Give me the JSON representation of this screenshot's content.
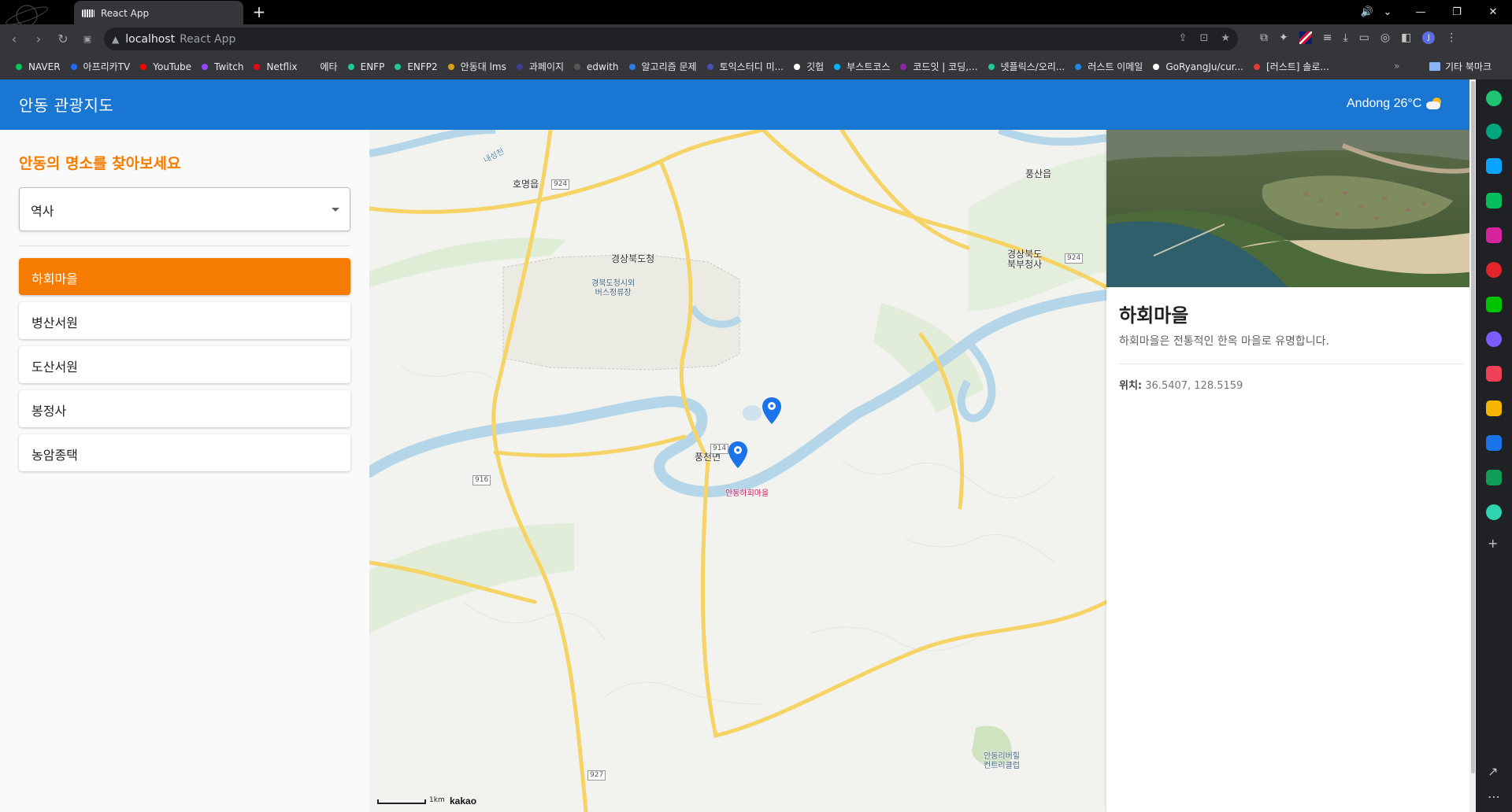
{
  "browser": {
    "tab_title": "React App",
    "new_tab_glyph": "+",
    "address_host": "localhost",
    "address_title": "React App",
    "bookmarks": [
      {
        "label": "NAVER",
        "color": "#03c75a"
      },
      {
        "label": "아프리카TV",
        "color": "#1e6cff"
      },
      {
        "label": "YouTube",
        "color": "#ff0000"
      },
      {
        "label": "Twitch",
        "color": "#9146ff"
      },
      {
        "label": "Netflix",
        "color": "#e50914"
      },
      {
        "label": "에타",
        "color": "#35363a"
      },
      {
        "label": "ENFP",
        "color": "#20c997"
      },
      {
        "label": "ENFP2",
        "color": "#20c997"
      },
      {
        "label": "안동대 lms",
        "color": "#d4a017"
      },
      {
        "label": "과페이지",
        "color": "#3a3f8f"
      },
      {
        "label": "edwith",
        "color": "#555555"
      },
      {
        "label": "알고리즘 문제",
        "color": "#2c7be5"
      },
      {
        "label": "토익스터디 미...",
        "color": "#4a4fb5"
      },
      {
        "label": "깃헙",
        "color": "#ffffff"
      },
      {
        "label": "부스트코스",
        "color": "#00b2ff"
      },
      {
        "label": "코드잇 | 코딩,...",
        "color": "#8e24aa"
      },
      {
        "label": "넷플릭스/오리...",
        "color": "#20c997"
      },
      {
        "label": "러스트 이메일",
        "color": "#1e88e5"
      },
      {
        "label": "GoRyangJu/cur...",
        "color": "#ffffff"
      },
      {
        "label": "[러스트] 솔로...",
        "color": "#e53935"
      }
    ],
    "bookmarks_more": "»",
    "other_bookmarks": "기타 북마크"
  },
  "app": {
    "title": "안동 관광지도",
    "weather": "Andong 26°C",
    "weather_icon": "partly-cloudy-icon",
    "sidebar": {
      "heading": "안동의 명소를 찾아보세요",
      "category_selected": "역사",
      "places": [
        {
          "label": "하회마을",
          "active": true
        },
        {
          "label": "병산서원",
          "active": false
        },
        {
          "label": "도산서원",
          "active": false
        },
        {
          "label": "봉정사",
          "active": false
        },
        {
          "label": "농암종택",
          "active": false
        }
      ]
    },
    "map": {
      "labels": {
        "hoemyeong": "호명읍",
        "gyeongbuk_office": "경상북도청",
        "bus_stop": "경북도청시외\n버스정류장",
        "pungsan": "풍산읍",
        "north_office": "경상북도\n북부청사",
        "pungcheon": "풍천면",
        "hahoe": "안동하회마을",
        "golf": "안동리버힐\n컨트리클럽",
        "river": "내성천",
        "scale": "1km",
        "provider": "kakao"
      },
      "road_numbers": [
        "924",
        "924",
        "914",
        "916",
        "927"
      ]
    },
    "detail": {
      "title": "하회마을",
      "description": "하회마을은 전통적인 한옥 마을로 유명합니다.",
      "location_label": "위치:",
      "location_value": "36.5407, 128.5159"
    }
  }
}
